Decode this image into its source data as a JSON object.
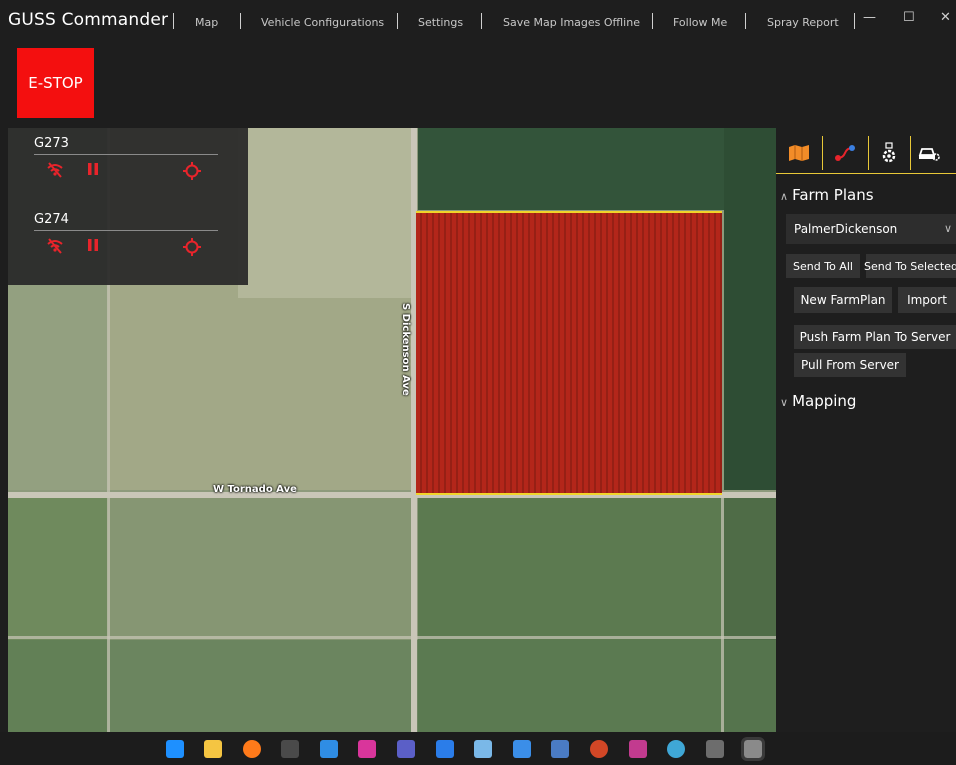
{
  "app": {
    "title": "GUSS Commander"
  },
  "nav": {
    "items": [
      "Map",
      "Vehicle Configurations",
      "Settings",
      "Save Map Images Offline",
      "Follow Me",
      "Spray Report"
    ]
  },
  "window_controls": {
    "minimize": "—",
    "maximize": "☐",
    "close": "✕"
  },
  "estop": {
    "label": "E-STOP",
    "color": "#f40f0f"
  },
  "vehicles": [
    {
      "name": "G273",
      "status_color": "#e8242b"
    },
    {
      "name": "G274",
      "status_color": "#e8242b"
    }
  ],
  "map": {
    "roads": [
      "S Dickenson Ave",
      "W Tornado Ave"
    ],
    "plan_color": "#b3261a",
    "boundary_color": "#f0d42a"
  },
  "panel": {
    "tabs": [
      "map-icon",
      "route-icon",
      "settings-icon",
      "vehicle-settings-icon"
    ],
    "farm_plans": {
      "title": "Farm Plans",
      "selected": "PalmerDickenson",
      "send_to_all": "Send To All",
      "send_to_selected": "Send To Selected",
      "new_farmplan": "New FarmPlan",
      "import": "Import",
      "push": "Push Farm Plan To Server",
      "pull": "Pull From Server"
    },
    "mapping": {
      "title": "Mapping"
    }
  },
  "taskbar": {
    "icons": [
      "windows-start-icon",
      "file-explorer-icon",
      "firefox-icon",
      "terminal-icon",
      "vscode-icon",
      "rider-icon",
      "teams-icon",
      "todo-icon",
      "photos-icon",
      "notepad-icon",
      "remote-desktop-icon",
      "powerpoint-icon",
      "snipping-icon",
      "paint-icon",
      "app-icon",
      "app-icon-active"
    ]
  }
}
